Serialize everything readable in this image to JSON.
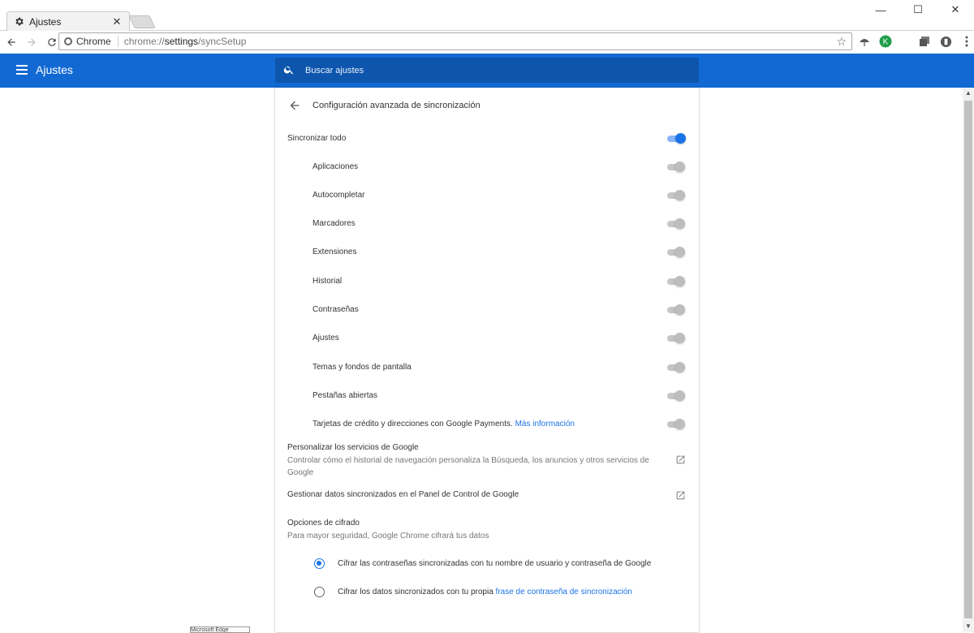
{
  "window": {
    "tab_title": "Ajustes",
    "tab_close": "✕",
    "minimize": "—",
    "maximize": "☐",
    "close": "✕"
  },
  "omnibox": {
    "site_label": "Chrome",
    "url_prefix": "chrome://",
    "url_host": "settings",
    "url_path": "/syncSetup"
  },
  "appbar": {
    "title": "Ajustes",
    "search_placeholder": "Buscar ajustes",
    "color": "#1269d3"
  },
  "sync": {
    "page_title": "Configuración avanzada de sincronización",
    "sync_all_label": "Sincronizar todo",
    "sync_all_on": true,
    "items": [
      {
        "label": "Aplicaciones",
        "on": false
      },
      {
        "label": "Autocompletar",
        "on": false
      },
      {
        "label": "Marcadores",
        "on": false
      },
      {
        "label": "Extensiones",
        "on": false
      },
      {
        "label": "Historial",
        "on": false
      },
      {
        "label": "Contraseñas",
        "on": false
      },
      {
        "label": "Ajustes",
        "on": false
      },
      {
        "label": "Temas y fondos de pantalla",
        "on": false
      },
      {
        "label": "Pestañas abiertas",
        "on": false
      },
      {
        "label": "Tarjetas de crédito y direcciones con Google Payments.",
        "link": "Más información",
        "on": false
      }
    ]
  },
  "personalize": {
    "title": "Personalizar los servicios de Google",
    "description": "Controlar cómo el historial de navegación personaliza la Búsqueda, los anuncios y otros servicios de Google"
  },
  "manage": {
    "title": "Gestionar datos sincronizados en el Panel de Control de Google"
  },
  "encryption": {
    "title": "Opciones de cifrado",
    "description": "Para mayor seguridad, Google Chrome cifrará tus datos",
    "option1": "Cifrar las contraseñas sincronizadas con tu nombre de usuario y contraseña de Google",
    "option2_text": "Cifrar los datos sincronizados con tu propia",
    "option2_link": "frase de contraseña de sincronización",
    "selected": 1
  },
  "accent": "#1a73e8",
  "tooltip_fragment": "Microsoft Edge"
}
